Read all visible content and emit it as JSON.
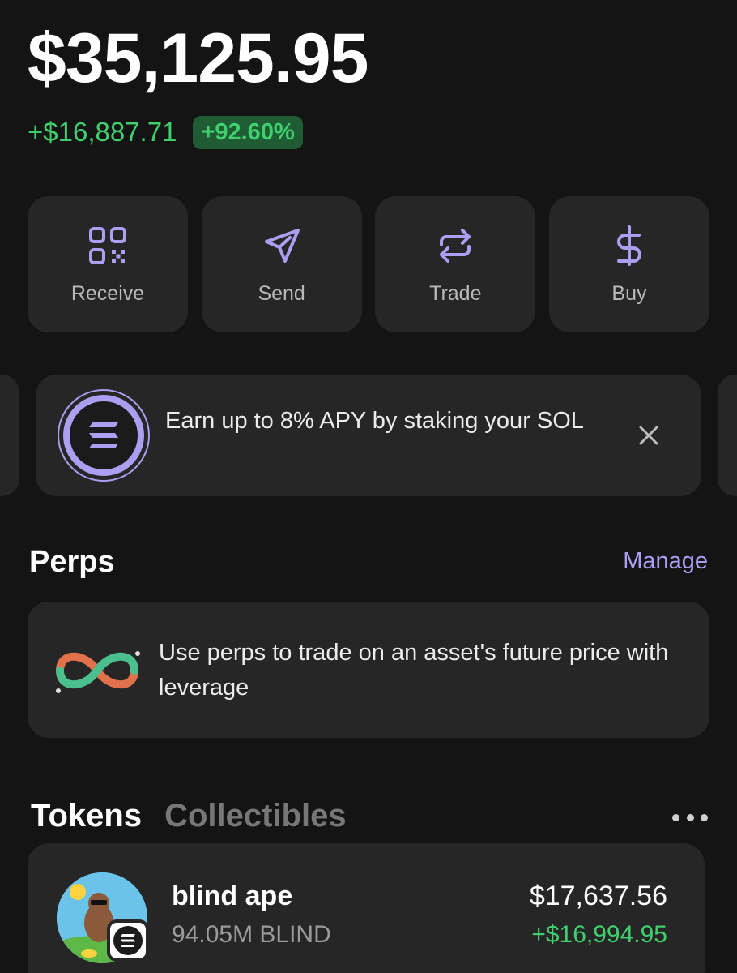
{
  "wallet": {
    "balance": "$35,125.95",
    "change_amount": "+$16,887.71",
    "change_percent": "+92.60%"
  },
  "actions": [
    {
      "label": "Receive",
      "icon": "qr-code-icon"
    },
    {
      "label": "Send",
      "icon": "send-arrow-icon"
    },
    {
      "label": "Trade",
      "icon": "swap-arrows-icon"
    },
    {
      "label": "Buy",
      "icon": "dollar-icon"
    }
  ],
  "promo": {
    "text": "Earn up to 8% APY by staking your SOL",
    "icon": "solana-logo-icon",
    "close_icon": "close-icon"
  },
  "perps": {
    "title": "Perps",
    "manage_label": "Manage",
    "description": "Use perps to trade on an asset's future price with leverage",
    "icon": "infinity-arrows-icon"
  },
  "tabs": {
    "tokens": "Tokens",
    "collectibles": "Collectibles",
    "more_icon": "more-horizontal-icon"
  },
  "tokens": [
    {
      "name": "blind ape",
      "amount": "94.05M BLIND",
      "value": "$17,637.56",
      "change": "+$16,994.95",
      "chain_icon": "solana-logo-icon"
    }
  ],
  "colors": {
    "background": "#141414",
    "card": "#262626",
    "accent": "#ab9ff2",
    "positive": "#3fcf6e",
    "positive_bg": "#1f5c34"
  }
}
